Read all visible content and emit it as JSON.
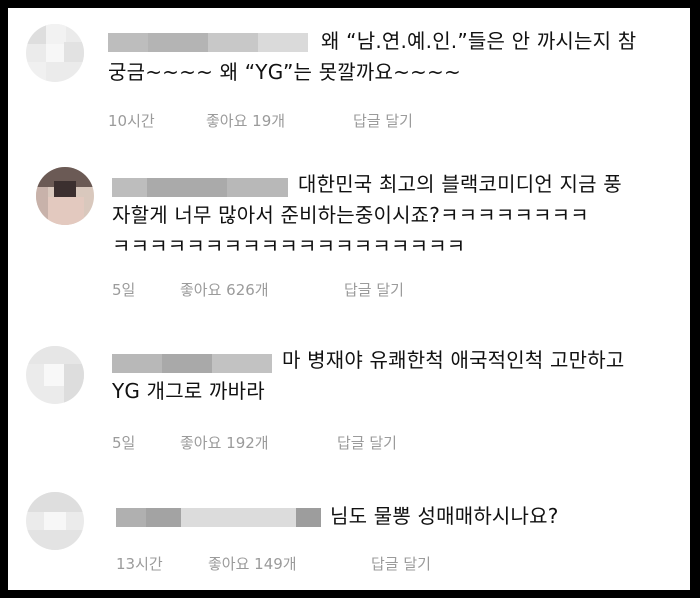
{
  "comments": [
    {
      "lines": [
        "왜 “남.연.예.인.”들은 안 까시는지 참",
        "궁금~~~~ 왜 “YG”는 못깔까요~~~~"
      ],
      "time": "10시간",
      "likes": "좋아요 19개",
      "reply": "답글 달기"
    },
    {
      "lines": [
        "대한민국 최고의 블랙코미디언 지금 풍",
        "자할게 너무 많아서 준비하는중이시죠?ㅋㅋㅋㅋㅋㅋㅋㅋ",
        "ㅋㅋㅋㅋㅋㅋㅋㅋㅋㅋㅋㅋㅋㅋㅋㅋㅋㅋㅋ"
      ],
      "time": "5일",
      "likes": "좋아요 626개",
      "reply": "답글 달기"
    },
    {
      "lines": [
        "마 병재야 유쾌한척 애국적인척 고만하고",
        "YG 개그로 까바라"
      ],
      "time": "5일",
      "likes": "좋아요 192개",
      "reply": "답글 달기"
    },
    {
      "lines": [
        "님도 물뽕 성매매하시나요?"
      ],
      "time": "13시간",
      "likes": "좋아요 149개",
      "reply": "답글 달기"
    }
  ]
}
